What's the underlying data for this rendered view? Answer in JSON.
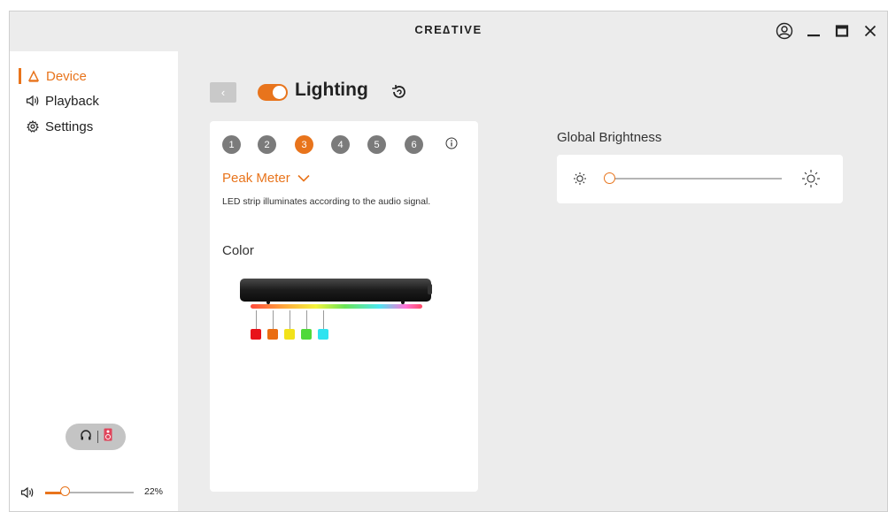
{
  "app": {
    "logo": "CRE∆TIVE"
  },
  "window": {
    "controls": [
      "account-icon",
      "minimize-icon",
      "maximize-icon",
      "close-icon"
    ]
  },
  "sidebar": {
    "items": [
      {
        "label": "Device",
        "icon": "device-icon",
        "active": true
      },
      {
        "label": "Playback",
        "icon": "speaker-icon",
        "active": false
      },
      {
        "label": "Settings",
        "icon": "gear-icon",
        "active": false
      }
    ],
    "output_toggle": {
      "left_icon": "headphones-icon",
      "right_icon": "speaker-device-icon"
    },
    "volume": {
      "value": 22,
      "label": "22%"
    }
  },
  "main": {
    "title": "Lighting",
    "toggle_on": true,
    "zones": [
      {
        "label": "1",
        "active": false
      },
      {
        "label": "2",
        "active": false
      },
      {
        "label": "3",
        "active": true
      },
      {
        "label": "4",
        "active": false
      },
      {
        "label": "5",
        "active": false
      },
      {
        "label": "6",
        "active": false
      }
    ],
    "mode": "Peak Meter",
    "description": "LED strip illuminates according to the audio signal.",
    "color_label": "Color",
    "swatches": [
      "#e8121a",
      "#ea6d12",
      "#f2e21a",
      "#4fd93a",
      "#2ee3f0"
    ],
    "global_brightness": {
      "label": "Global Brightness",
      "value": 0
    }
  },
  "colors": {
    "accent": "#e8741c",
    "inactive_zone": "#7b7b7b"
  }
}
